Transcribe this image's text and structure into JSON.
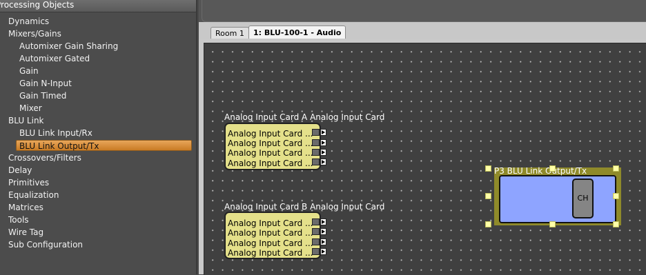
{
  "left_panel": {
    "header": "Processing Objects",
    "items": [
      {
        "label": "Dynamics"
      },
      {
        "label": "Mixers/Gains"
      },
      {
        "label": "Automixer Gain Sharing"
      },
      {
        "label": "Automixer Gated"
      },
      {
        "label": "Gain"
      },
      {
        "label": "Gain N-Input"
      },
      {
        "label": "Gain Timed"
      },
      {
        "label": "Mixer"
      },
      {
        "label": "BLU Link"
      },
      {
        "label": "BLU Link Input/Rx"
      },
      {
        "label": "BLU Link Output/Tx",
        "selected": true
      },
      {
        "label": "Crossovers/Filters"
      },
      {
        "label": "Delay"
      },
      {
        "label": "Primitives"
      },
      {
        "label": "Equalization"
      },
      {
        "label": "Matrices"
      },
      {
        "label": "Tools"
      },
      {
        "label": "Wire Tag"
      },
      {
        "label": "Sub Configuration"
      }
    ]
  },
  "tabs": [
    {
      "label": "Room 1"
    },
    {
      "label": "1: BLU-100-1 - Audio",
      "active": true
    }
  ],
  "canvas": {
    "card_a": {
      "title": "Analog Input Card A  Analog Input Card",
      "rows": [
        "Analog Input Card ...",
        "Analog Input Card ...",
        "Analog Input Card ...",
        "Analog Input Card ..."
      ]
    },
    "card_b": {
      "title": "Analog Input Card B  Analog Input Card",
      "rows": [
        "Analog Input Card ...",
        "Analog Input Card ...",
        "Analog Input Card ...",
        "Analog Input Card ..."
      ]
    },
    "p3_block": {
      "title": "P3  BLU Link Output/Tx",
      "channel_label": "CH"
    }
  },
  "colors": {
    "selected_item": "#d98f3a",
    "card_fill": "#e4e08a",
    "blu_block_fill": "#8ea4ff",
    "selection_frame": "#8f8a2a"
  }
}
